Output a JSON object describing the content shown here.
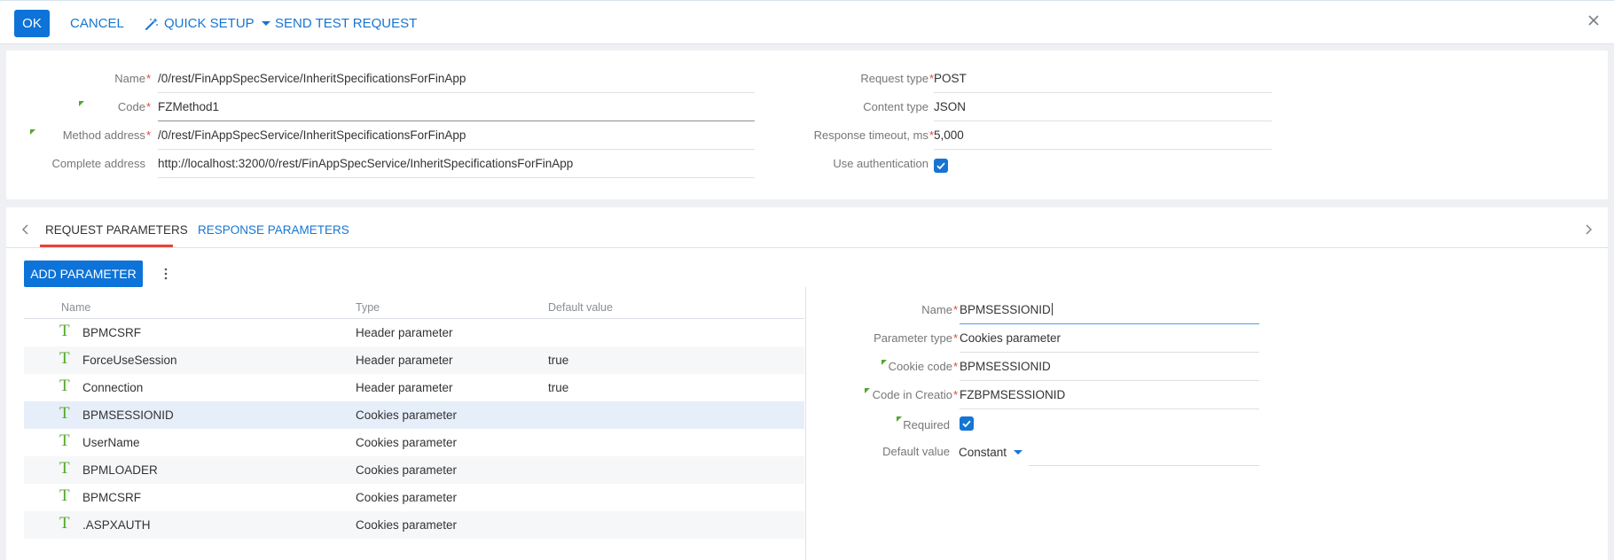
{
  "toolbar": {
    "ok": "OK",
    "cancel": "CANCEL",
    "quick_setup": "QUICK SETUP",
    "send_test": "SEND TEST REQUEST"
  },
  "header": {
    "name_label": "Name",
    "name_value": "/0/rest/FinAppSpecService/InheritSpecificationsForFinApp",
    "code_label": "Code",
    "code_value": "FZMethod1",
    "method_label": "Method address",
    "method_value": "/0/rest/FinAppSpecService/InheritSpecificationsForFinApp",
    "complete_label": "Complete address",
    "complete_value": "http://localhost:3200/0/rest/FinAppSpecService/InheritSpecificationsForFinApp",
    "request_type_label": "Request type",
    "request_type_value": "POST",
    "content_type_label": "Content type",
    "content_type_value": "JSON",
    "timeout_label": "Response timeout, ms",
    "timeout_value": "5,000",
    "auth_label": "Use authentication",
    "auth_checked": true,
    "required_mark": "*"
  },
  "tabs": [
    {
      "label": "REQUEST PARAMETERS",
      "active": true
    },
    {
      "label": "RESPONSE PARAMETERS",
      "active": false
    }
  ],
  "params": {
    "add_button": "ADD PARAMETER",
    "columns": [
      "Name",
      "Type",
      "Default value"
    ],
    "rows": [
      {
        "name": "BPMCSRF",
        "type": "Header parameter",
        "default": ""
      },
      {
        "name": "ForceUseSession",
        "type": "Header parameter",
        "default": "true"
      },
      {
        "name": "Connection",
        "type": "Header parameter",
        "default": "true"
      },
      {
        "name": "BPMSESSIONID",
        "type": "Cookies parameter",
        "default": ""
      },
      {
        "name": "UserName",
        "type": "Cookies parameter",
        "default": ""
      },
      {
        "name": "BPMLOADER",
        "type": "Cookies parameter",
        "default": ""
      },
      {
        "name": "BPMCSRF",
        "type": "Cookies parameter",
        "default": ""
      },
      {
        "name": ".ASPXAUTH",
        "type": "Cookies parameter",
        "default": ""
      }
    ],
    "selected_index": 3
  },
  "detail": {
    "name_label": "Name",
    "name_value": "BPMSESSIONID",
    "ptype_label": "Parameter type",
    "ptype_value": "Cookies parameter",
    "cookie_label": "Cookie code",
    "cookie_value": "BPMSESSIONID",
    "creatio_label": "Code in Creatio",
    "creatio_value": "FZBPMSESSIONID",
    "required_label": "Required",
    "required_checked": true,
    "default_label": "Default value",
    "default_mode": "Constant",
    "default_value": ""
  },
  "colors": {
    "accent": "#0d73d8",
    "link": "#1775d2",
    "required": "#e8443a",
    "flag": "#52a82a",
    "selected_row": "#e6eef9"
  }
}
